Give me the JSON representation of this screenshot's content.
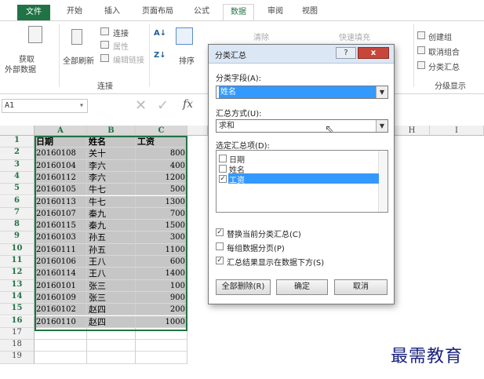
{
  "tabs": [
    {
      "label": "文件"
    },
    {
      "label": "开始"
    },
    {
      "label": "插入"
    },
    {
      "label": "页面布局"
    },
    {
      "label": "公式"
    },
    {
      "label": "数据"
    },
    {
      "label": "审阅"
    },
    {
      "label": "视图"
    }
  ],
  "ribbon": {
    "get_external": "获取\n外部数据",
    "get_external_l1": "获取",
    "get_external_l2": "外部数据",
    "refresh_all": "全部刷新",
    "connections": "连接",
    "properties": "属性",
    "edit_links": "编辑链接",
    "group_connections": "连接",
    "sort": "排序",
    "clear": "清除",
    "flash_fill": "快速填充",
    "group": "创建组",
    "ungroup": "取消组合",
    "subtotal": "分类汇总",
    "group_outline": "分级显示"
  },
  "formula": {
    "name_box": "A1",
    "fx": "fx"
  },
  "columns": {
    "a": "A",
    "b": "B",
    "c": "C",
    "h": "H",
    "i": "I"
  },
  "header_row": {
    "date": "日期",
    "name": "姓名",
    "salary": "工资"
  },
  "rows": [
    {
      "n": "2",
      "date": "20160108",
      "name": "关十",
      "salary": "800"
    },
    {
      "n": "3",
      "date": "20160104",
      "name": "李六",
      "salary": "400"
    },
    {
      "n": "4",
      "date": "20160112",
      "name": "李六",
      "salary": "1200"
    },
    {
      "n": "5",
      "date": "20160105",
      "name": "牛七",
      "salary": "500"
    },
    {
      "n": "6",
      "date": "20160113",
      "name": "牛七",
      "salary": "1300"
    },
    {
      "n": "7",
      "date": "20160107",
      "name": "秦九",
      "salary": "700"
    },
    {
      "n": "8",
      "date": "20160115",
      "name": "秦九",
      "salary": "1500"
    },
    {
      "n": "9",
      "date": "20160103",
      "name": "孙五",
      "salary": "300"
    },
    {
      "n": "10",
      "date": "20160111",
      "name": "孙五",
      "salary": "1100"
    },
    {
      "n": "11",
      "date": "20160106",
      "name": "王八",
      "salary": "600"
    },
    {
      "n": "12",
      "date": "20160114",
      "name": "王八",
      "salary": "1400"
    },
    {
      "n": "13",
      "date": "20160101",
      "name": "张三",
      "salary": "100"
    },
    {
      "n": "14",
      "date": "20160109",
      "name": "张三",
      "salary": "900"
    },
    {
      "n": "15",
      "date": "20160102",
      "name": "赵四",
      "salary": "200"
    },
    {
      "n": "16",
      "date": "20160110",
      "name": "赵四",
      "salary": "1000"
    }
  ],
  "extra_rows": [
    "17",
    "18",
    "19"
  ],
  "row1": "1",
  "dialog": {
    "title": "分类汇总",
    "help": "?",
    "close": "x",
    "field_label": "分类字段(A):",
    "field_value": "姓名",
    "method_label": "汇总方式(U):",
    "method_value": "求和",
    "items_label": "选定汇总项(D):",
    "items": [
      {
        "label": "日期",
        "checked": false
      },
      {
        "label": "姓名",
        "checked": false
      },
      {
        "label": "工资",
        "checked": true
      }
    ],
    "opt_replace": "替换当前分类汇总(C)",
    "opt_pagebreak": "每组数据分页(P)",
    "opt_below": "汇总结果显示在数据下方(S)",
    "btn_remove": "全部删除(R)",
    "btn_ok": "确定",
    "btn_cancel": "取消"
  },
  "watermark": "最需教育",
  "colors": {
    "file_tab": "#217346",
    "selection": "#c6c6c6",
    "highlight": "#3399ff"
  }
}
